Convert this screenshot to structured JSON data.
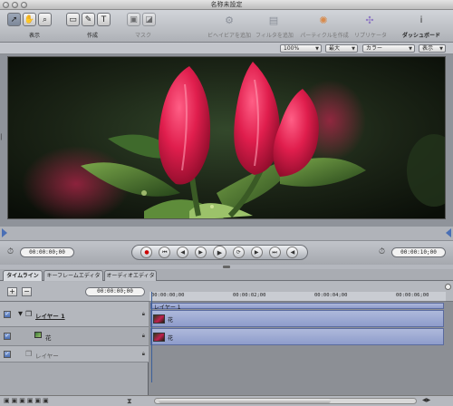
{
  "window": {
    "title": "名称未設定"
  },
  "toolbar": {
    "groups": [
      {
        "label": "表示"
      },
      {
        "label": "作成"
      },
      {
        "label": "マスク"
      }
    ],
    "actions": [
      {
        "label": "ビヘイビアを追加"
      },
      {
        "label": "フィルタを追加"
      },
      {
        "label": "パーティクルを作成"
      },
      {
        "label": "リプリケータ"
      },
      {
        "label": "ダッシュボード"
      }
    ]
  },
  "view_options": {
    "zoom": "100%",
    "resolution": "最大",
    "channel": "カラー",
    "display": "表示"
  },
  "transport": {
    "start_time": "00:00:00;00",
    "end_time": "00:00:10;00"
  },
  "tabs": [
    {
      "label": "タイムライン",
      "active": true
    },
    {
      "label": "キーフレームエディタ",
      "active": false
    },
    {
      "label": "オーディオエディタ",
      "active": false
    }
  ],
  "timeline": {
    "current_time": "00:00:00;00",
    "ruler": [
      "00:00:00;00",
      "00:00:02;00",
      "00:00:04;00",
      "00:00:06;00"
    ],
    "layers": [
      {
        "name": "レイヤー 1",
        "bar_label": "レイヤー 1",
        "sub_label": "花"
      },
      {
        "name": "花",
        "bar_label": "花"
      },
      {
        "name": "レイヤー"
      }
    ]
  },
  "colors": {
    "accent": "#8e9ccb",
    "flower": "#d81e4a"
  }
}
